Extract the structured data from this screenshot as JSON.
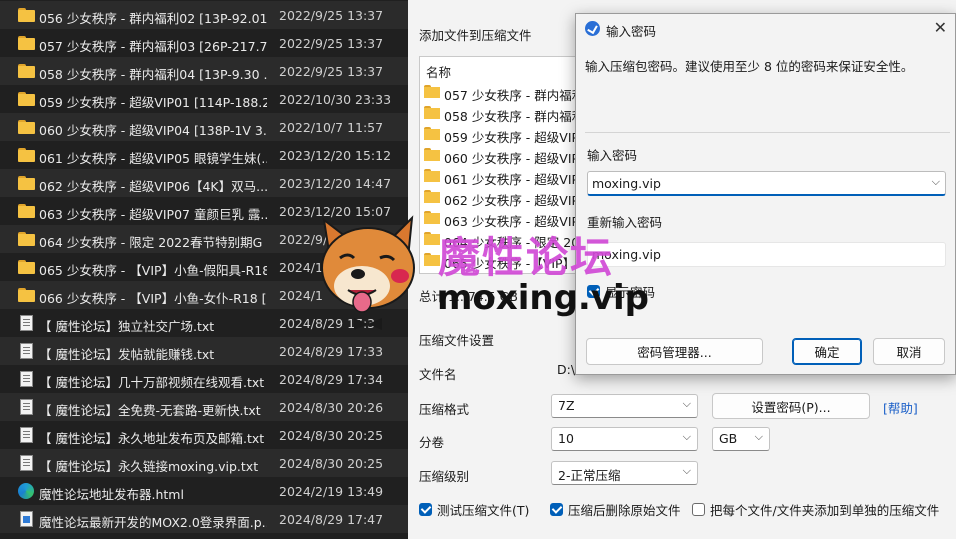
{
  "explorer": {
    "rows": [
      {
        "type": "folder",
        "name": "056 少女秩序 - 群内福利02 [13P-92.01 ...",
        "date": "2022/9/25 13:37"
      },
      {
        "type": "folder",
        "name": "057 少女秩序 - 群内福利03 [26P-217.7...",
        "date": "2022/9/25 13:37"
      },
      {
        "type": "folder",
        "name": "058 少女秩序 - 群内福利04 [13P-9.30 ...",
        "date": "2022/9/25 13:37"
      },
      {
        "type": "folder",
        "name": "059 少女秩序 - 超级VIP01 [114P-188.2...",
        "date": "2022/10/30 23:33"
      },
      {
        "type": "folder",
        "name": "060 少女秩序 - 超级VIP04 [138P-1V 3....",
        "date": "2022/10/7 11:57"
      },
      {
        "type": "folder",
        "name": "061 少女秩序 - 超级VIP05 眼镜学生妹(...",
        "date": "2023/12/20 15:12"
      },
      {
        "type": "folder",
        "name": "062 少女秩序 - 超级VIP06【4K】双马...",
        "date": "2023/12/20 14:47"
      },
      {
        "type": "folder",
        "name": "063 少女秩序 - 超级VIP07 童颜巨乳 露...",
        "date": "2023/12/20 15:07"
      },
      {
        "type": "folder",
        "name": "064 少女秩序 - 限定 2022春节特别期G ...",
        "date": "2022/9/"
      },
      {
        "type": "folder",
        "name": "065 少女秩序 - 【VIP】小鱼-假阳具-R18...",
        "date": "2024/1"
      },
      {
        "type": "folder",
        "name": "066 少女秩序 - 【VIP】小鱼-女仆-R18 [...",
        "date": "2024/1"
      },
      {
        "type": "txt",
        "name": "【 魔性论坛】独立社交广场.txt",
        "date": "2024/8/29 17:3"
      },
      {
        "type": "txt",
        "name": "【 魔性论坛】发帖就能赚钱.txt",
        "date": "2024/8/29 17:33"
      },
      {
        "type": "txt",
        "name": "【 魔性论坛】几十万部视频在线观看.txt",
        "date": "2024/8/29 17:34"
      },
      {
        "type": "txt",
        "name": "【 魔性论坛】全免费-无套路-更新快.txt",
        "date": "2024/8/30 20:26"
      },
      {
        "type": "txt",
        "name": "【 魔性论坛】永久地址发布页及邮箱.txt",
        "date": "2024/8/30 20:25"
      },
      {
        "type": "txt",
        "name": "【 魔性论坛】永久链接moxing.vip.txt",
        "date": "2024/8/30 20:25"
      },
      {
        "type": "edge",
        "name": "魔性论坛地址发布器.html",
        "date": "2024/2/19 13:49"
      },
      {
        "type": "html",
        "name": "魔性论坛最新开发的MOX2.0登录界面.p...",
        "date": "2024/8/29 17:47"
      }
    ]
  },
  "archive_dialog": {
    "header": "添加文件到压缩文件",
    "list_header": "名称",
    "list_rows": [
      "057 少女秩序 - 群内福利",
      "058 少女秩序 - 群内福利",
      "059 少女秩序 - 超级VIP0",
      "060 少女秩序 - 超级VIP0",
      "061 少女秩序 - 超级VIP0",
      "062 少女秩序 - 超级VIP0",
      "063 少女秩序 - 超级VIP0",
      "064 少女秩序 - 限定 20",
      "065 少女秩序 -【VIP】"
    ],
    "total": "总计 1...74.5 GB",
    "settings_title": "压缩文件设置",
    "filename_label": "文件名",
    "filename_value": "D:\\",
    "format_label": "压缩格式",
    "format_value": "7Z",
    "set_password_button": "设置密码(P)...",
    "help_link": "[帮助]",
    "split_label": "分卷",
    "split_value": "10",
    "split_unit": "GB",
    "level_label": "压缩级别",
    "level_value": "2-正常压缩",
    "check_test": "测试压缩文件(T)",
    "check_delete": "压缩后删除原始文件",
    "check_separate": "把每个文件/文件夹添加到单独的压缩文件"
  },
  "password_dialog": {
    "title": "输入密码",
    "description": "输入压缩包密码。建议使用至少 8 位的密码来保证安全性。",
    "password_label": "输入密码",
    "password_value": "moxing.vip",
    "reenter_label": "重新输入密码",
    "reenter_value": "moxing.vip",
    "show_password": "显示密码",
    "manager_button": "密码管理器...",
    "ok_button": "确定",
    "cancel_button": "取消"
  },
  "watermark": {
    "text": "魔性论坛",
    "url": "moxing.vip"
  },
  "colors": {
    "accent": "#005fb8",
    "folder": "#f5c242",
    "watermark": "#d14ad6"
  }
}
